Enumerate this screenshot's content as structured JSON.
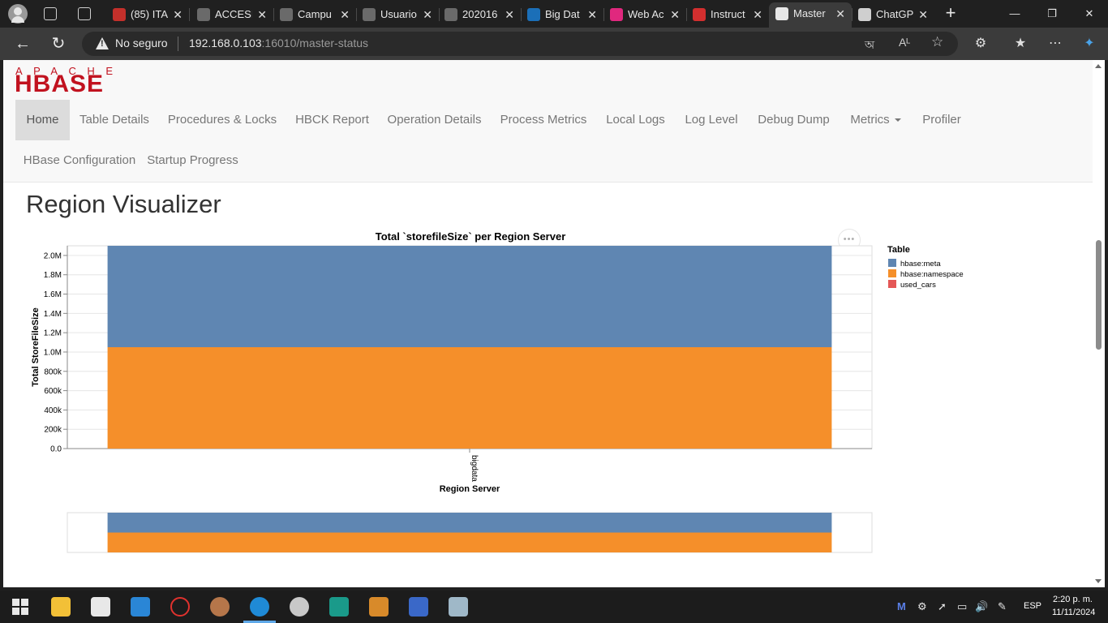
{
  "browser": {
    "tabs": [
      {
        "label": "(85) ITA",
        "fav_color": "#c4302b"
      },
      {
        "label": "ACCESI",
        "fav_color": "#6a6a6a"
      },
      {
        "label": "Campu",
        "fav_color": "#6a6a6a"
      },
      {
        "label": "Usuario",
        "fav_color": "#6a6a6a"
      },
      {
        "label": "202016",
        "fav_color": "#6a6a6a"
      },
      {
        "label": "Big Dat",
        "fav_color": "#1b6fb8"
      },
      {
        "label": "Web Ac",
        "fav_color": "#e0287e"
      },
      {
        "label": "Instruct",
        "fav_color": "#d32f2f"
      },
      {
        "label": "Master",
        "fav_color": "#e8e8e8"
      },
      {
        "label": "ChatGP",
        "fav_color": "#cfcfcf"
      }
    ],
    "security_label": "No seguro",
    "url_host": "192.168.0.103",
    "url_rest": ":16010/master-status",
    "accent": "#3b3b3b"
  },
  "hbase": {
    "logo_top": "APACHE",
    "logo_main": "HBASE",
    "logo_color": "#c1121f",
    "nav": [
      {
        "label": "Home",
        "active": true
      },
      {
        "label": "Table Details"
      },
      {
        "label": "Procedures & Locks"
      },
      {
        "label": "HBCK Report"
      },
      {
        "label": "Operation Details"
      },
      {
        "label": "Process Metrics"
      },
      {
        "label": "Local Logs"
      },
      {
        "label": "Log Level"
      },
      {
        "label": "Debug Dump"
      },
      {
        "label": "Metrics"
      },
      {
        "label": "Profiler"
      },
      {
        "label": "HBase Configuration"
      },
      {
        "label": "Startup Progress"
      }
    ],
    "page_title": "Region Visualizer",
    "chart_menu": "•••"
  },
  "chart_data": {
    "type": "bar",
    "stacked": true,
    "title": "Total `storefileSize` per Region Server",
    "xlabel": "Region Server",
    "ylabel": "Total StoreFileSize",
    "categories": [
      "bigdata"
    ],
    "series": [
      {
        "name": "hbase:namespace",
        "values": [
          1050000
        ],
        "color": "#f58f2a"
      },
      {
        "name": "hbase:meta",
        "values": [
          1050000
        ],
        "color": "#5f86b2"
      },
      {
        "name": "used_cars",
        "values": [
          0
        ],
        "color": "#e45756"
      }
    ],
    "legend_title": "Table",
    "legend_order": [
      "hbase:meta",
      "hbase:namespace",
      "used_cars"
    ],
    "ylim": [
      0,
      2100000
    ],
    "yticks": [
      0,
      200000,
      400000,
      600000,
      800000,
      1000000,
      1200000,
      1400000,
      1600000,
      1800000,
      2000000
    ],
    "ytick_labels": [
      "0.0",
      "200k",
      "400k",
      "600k",
      "800k",
      "1.0M",
      "1.2M",
      "1.4M",
      "1.6M",
      "1.8M",
      "2.0M"
    ],
    "grid": true,
    "legend_position": "right"
  },
  "taskbar": {
    "language": "ESP",
    "time": "2:20 p. m.",
    "date": "11/11/2024"
  }
}
